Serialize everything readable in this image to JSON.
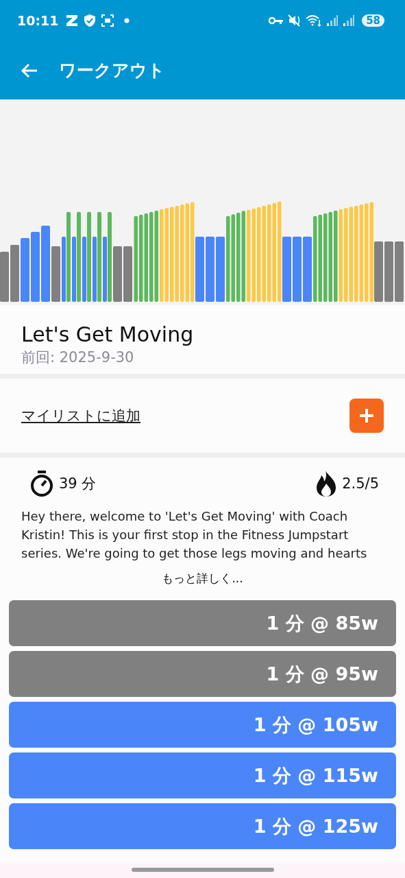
{
  "status_bar": {
    "time": "10:11",
    "battery": "58"
  },
  "app_bar": {
    "title": "ワークアウト"
  },
  "workout": {
    "title": "Let's Get Moving",
    "last_done": "前回: 2025-9-30"
  },
  "my_list": {
    "label": "マイリストに追加"
  },
  "stats": {
    "duration": "39 分",
    "intensity": "2.5/5"
  },
  "description": "Hey there, welcome to 'Let's Get Moving' with Coach Kristin! This is your first stop in the Fitness Jumpstart series. We're going to get those legs moving and hearts",
  "more_link": "もっと詳しく...",
  "intervals": [
    {
      "label": "1 分 @ 85w",
      "color": "#808080"
    },
    {
      "label": "1 分 @ 95w",
      "color": "#808080"
    },
    {
      "label": "1 分 @ 105w",
      "color": "#4a86f7"
    },
    {
      "label": "1 分 @ 115w",
      "color": "#4a86f7"
    },
    {
      "label": "1 分 @ 125w",
      "color": "#4a86f7"
    }
  ]
}
